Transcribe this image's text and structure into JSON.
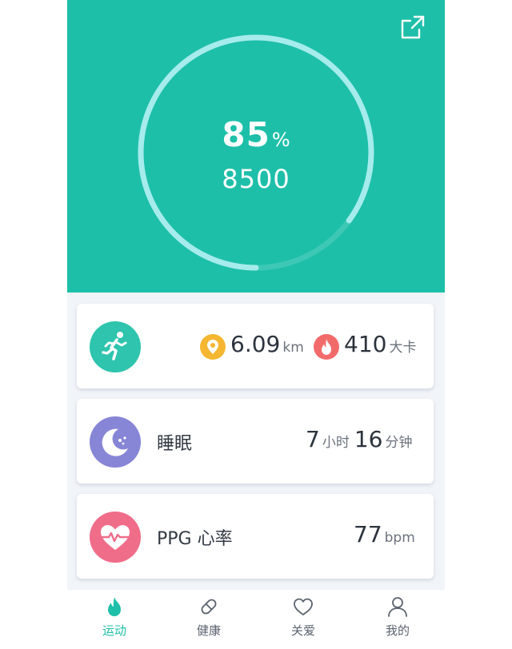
{
  "header": {
    "goal_percent": "85",
    "percent_unit": "%",
    "steps": "8500",
    "progress_fraction": 0.85
  },
  "activity": {
    "distance_value": "6.09",
    "distance_unit": "km",
    "calories_value": "410",
    "calories_unit": "大卡"
  },
  "sleep": {
    "label": "睡眠",
    "hours_value": "7",
    "hours_unit": "小时",
    "minutes_value": "16",
    "minutes_unit": "分钟"
  },
  "heart_rate": {
    "label": "PPG 心率",
    "value": "77",
    "unit": "bpm"
  },
  "tabs": [
    {
      "label": "运动",
      "icon": "flame-icon",
      "active": true
    },
    {
      "label": "健康",
      "icon": "pill-icon",
      "active": false
    },
    {
      "label": "关爱",
      "icon": "heart-outline-icon",
      "active": false
    },
    {
      "label": "我的",
      "icon": "user-icon",
      "active": false
    }
  ],
  "colors": {
    "brand": "#1ebfa9",
    "activity_icon": "#2ec4ad",
    "sleep_icon": "#8785d6",
    "heart_icon": "#f06d8a",
    "distance_icon": "#f5b731",
    "calories_icon": "#f26b6b"
  }
}
